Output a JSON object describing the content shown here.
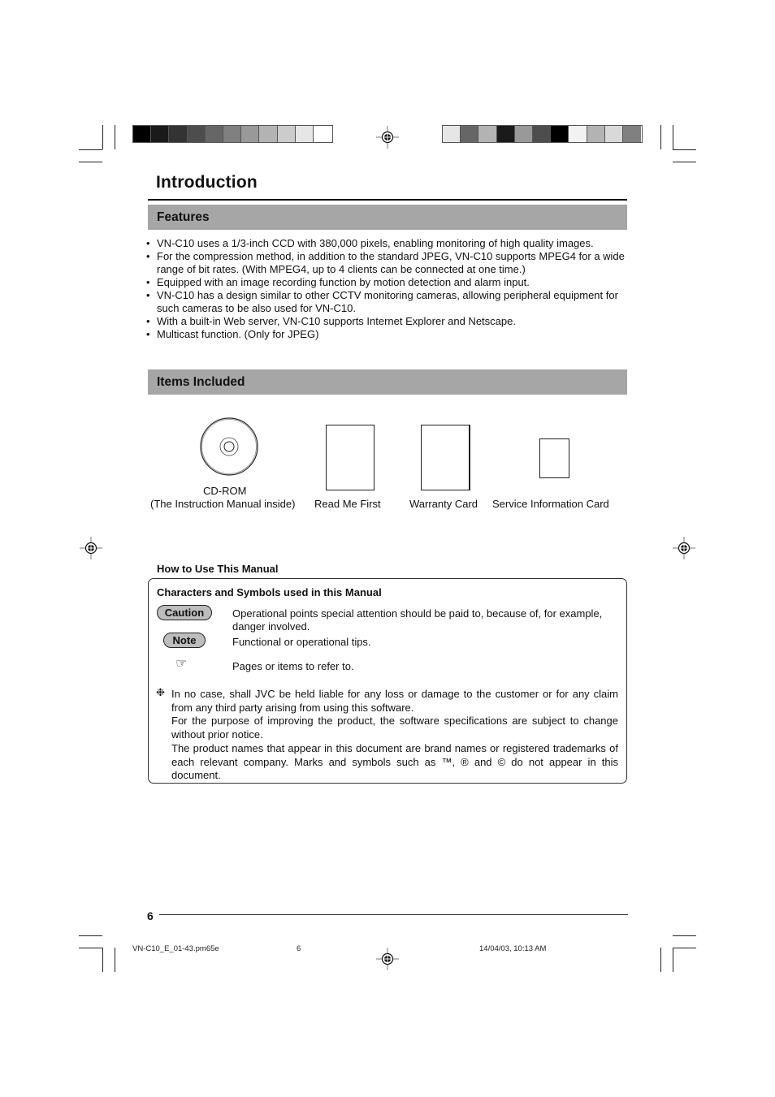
{
  "header": {
    "colorbar_left": [
      "#000000",
      "#1a1a1a",
      "#333333",
      "#4d4d4d",
      "#666666",
      "#808080",
      "#999999",
      "#b3b3b3",
      "#cccccc",
      "#e6e6e6",
      "#ffffff"
    ],
    "colorbar_right": [
      "#e6e6e6",
      "#666666",
      "#b3b3b3",
      "#1a1a1a",
      "#999999",
      "#4d4d4d",
      "#000000",
      "#f2f2f2",
      "#b3b3b3",
      "#d9d9d9",
      "#808080"
    ]
  },
  "page": {
    "title": "Introduction"
  },
  "features": {
    "heading": "Features",
    "items": [
      "VN-C10 uses a 1/3-inch CCD with 380,000 pixels, enabling monitoring of high quality images.",
      "For the compression method, in addition to the standard JPEG, VN-C10 supports MPEG4 for a wide range of bit rates. (With MPEG4, up to 4 clients can be connected at one time.)",
      "Equipped with an image recording function by motion detection and alarm input.",
      "VN-C10 has a design similar to other CCTV monitoring cameras, allowing peripheral equipment for such cameras to be also used for VN-C10.",
      "With a built-in Web server, VN-C10 supports Internet Explorer and Netscape.",
      "Multicast function. (Only for JPEG)"
    ]
  },
  "items_included": {
    "heading": "Items Included",
    "items": [
      {
        "icon": "cd-rom-icon",
        "label_line1": "CD-ROM",
        "label_line2": "(The Instruction Manual inside)"
      },
      {
        "icon": "document-icon",
        "label_line1": "Read Me First"
      },
      {
        "icon": "card-icon",
        "label_line1": "Warranty Card"
      },
      {
        "icon": "small-card-icon",
        "label_line1": "Service Information Card"
      }
    ]
  },
  "how_to_use": {
    "title": "How to Use This Manual",
    "box_heading": "Characters and Symbols used in this Manual",
    "symbols": [
      {
        "badge": "Caution",
        "description": "Operational points special attention should be paid to, because of, for example, danger involved."
      },
      {
        "badge": "Note",
        "description": "Functional or operational tips."
      },
      {
        "glyph": "☞",
        "description": "Pages or items to refer to."
      }
    ],
    "notes_marker": "❉",
    "notes": [
      "In no case, shall JVC be held liable for any loss or damage to the customer or for any claim from any third party arising from using this software.",
      "For the purpose of improving the product, the software specifications are subject to change without prior notice.",
      "The product names that appear in this document are brand names or registered trademarks of each relevant company. Marks and symbols such as ™, ® and © do not appear in this document."
    ]
  },
  "footer": {
    "page_number": "6",
    "slug_file": "VN-C10_E_01-43.pm65e",
    "slug_page": "6",
    "slug_date": "14/04/03, 10:13 AM"
  }
}
